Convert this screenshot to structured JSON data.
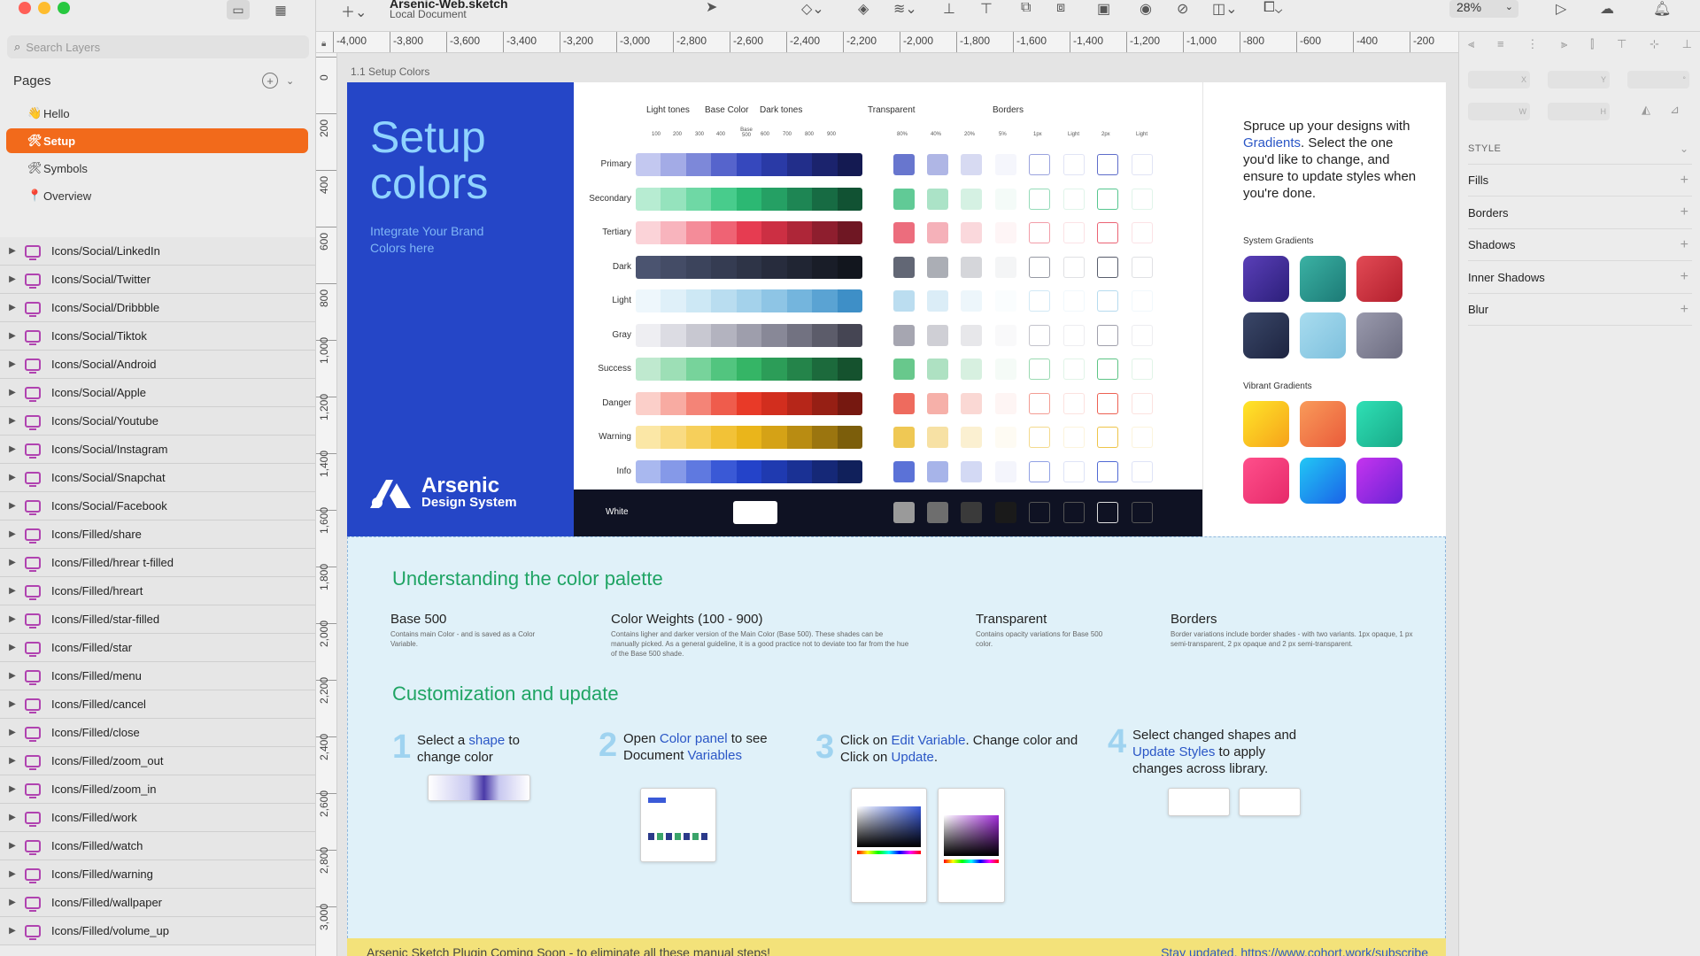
{
  "window": {
    "title": "Arsenic-Web.sketch",
    "subtitle": "Local Document",
    "zoom": "28%"
  },
  "sidebar": {
    "search_placeholder": "Search Layers",
    "pages_label": "Pages",
    "pages": [
      {
        "label": "Hello",
        "icon": "hand-icon",
        "glyph": "👋"
      },
      {
        "label": "Setup",
        "icon": "tools-icon",
        "glyph": "🛠"
      },
      {
        "label": "Symbols",
        "icon": "tools-icon",
        "glyph": "🛠"
      },
      {
        "label": "Overview",
        "icon": "pin-icon",
        "glyph": "📍"
      }
    ],
    "layers": [
      "Icons/Social/LinkedIn",
      "Icons/Social/Twitter",
      "Icons/Social/Dribbble",
      "Icons/Social/Tiktok",
      "Icons/Social/Android",
      "Icons/Social/Apple",
      "Icons/Social/Youtube",
      "Icons/Social/Instagram",
      "Icons/Social/Snapchat",
      "Icons/Social/Facebook",
      "Icons/Filled/share",
      "Icons/Filled/hrear t-filled",
      "Icons/Filled/hreart",
      "Icons/Filled/star-filled",
      "Icons/Filled/star",
      "Icons/Filled/menu",
      "Icons/Filled/cancel",
      "Icons/Filled/close",
      "Icons/Filled/zoom_out",
      "Icons/Filled/zoom_in",
      "Icons/Filled/work",
      "Icons/Filled/watch",
      "Icons/Filled/warning",
      "Icons/Filled/wallpaper",
      "Icons/Filled/volume_up"
    ]
  },
  "ruler": {
    "h": [
      "-4,000",
      "-3,800",
      "-3,600",
      "-3,400",
      "-3,200",
      "-3,000",
      "-2,800",
      "-2,600",
      "-2,400",
      "-2,200",
      "-2,000",
      "-1,800",
      "-1,600",
      "-1,400",
      "-1,200",
      "-1,000",
      "-800",
      "-600",
      "-400",
      "-200"
    ],
    "v": [
      "0",
      "200",
      "400",
      "600",
      "800",
      "1,000",
      "1,200",
      "1,400",
      "1,600",
      "1,800",
      "2,000",
      "2,200",
      "2,400",
      "2,600",
      "2,800",
      "3,000"
    ]
  },
  "artboard": {
    "label": "1.1 Setup Colors"
  },
  "hero": {
    "title": "Setup colors",
    "subtitle": "Integrate Your Brand Colors here",
    "logo_word": "Arsenic",
    "logo_sub": "Design System"
  },
  "palette": {
    "groups": {
      "light": "Light tones",
      "base": "Base Color",
      "dark": "Dark tones",
      "transparent": "Transparent",
      "borders": "Borders"
    },
    "weights": [
      "100",
      "200",
      "300",
      "400",
      "Base 500",
      "600",
      "700",
      "800",
      "900"
    ],
    "transparency": [
      "80%",
      "40%",
      "20%",
      "5%"
    ],
    "border_labels": [
      "1px",
      "Light",
      "2px",
      "Light"
    ],
    "rows": [
      {
        "name": "Primary",
        "colors": [
          "#c3c8f0",
          "#a3abe6",
          "#7d88d9",
          "#5664cc",
          "#3648bd",
          "#2a3aa6",
          "#222e8a",
          "#1b236d",
          "#141a52"
        ],
        "tint": "#3648bd"
      },
      {
        "name": "Secondary",
        "colors": [
          "#b7ecd2",
          "#95e3bd",
          "#6fd8a5",
          "#48cc8c",
          "#2cb873",
          "#25a064",
          "#1e8654",
          "#176b43",
          "#115233"
        ],
        "tint": "#2cb873"
      },
      {
        "name": "Tertiary",
        "colors": [
          "#fbd3d8",
          "#f8b4bd",
          "#f48c99",
          "#ef6374",
          "#e63c51",
          "#cc2f43",
          "#ae2638",
          "#8e1e2e",
          "#6f1723"
        ],
        "tint": "#e63c51"
      },
      {
        "name": "Dark",
        "colors": [
          "#4b5470",
          "#444c66",
          "#3c445c",
          "#353c52",
          "#2e3447",
          "#272c3d",
          "#202533",
          "#191d28",
          "#12161e"
        ],
        "tint": "#2e3447"
      },
      {
        "name": "Light",
        "colors": [
          "#eef7fc",
          "#dff0f9",
          "#cde8f5",
          "#b9ddf0",
          "#a4d2eb",
          "#8ec5e5",
          "#74b5dd",
          "#5aa3d3",
          "#3e8fc7"
        ],
        "tint": "#a4d2eb"
      },
      {
        "name": "Gray",
        "colors": [
          "#eeeef2",
          "#dcdce3",
          "#c8c8d1",
          "#b3b3bf",
          "#9e9eac",
          "#888897",
          "#727281",
          "#5c5c6a",
          "#454553"
        ],
        "tint": "#888897"
      },
      {
        "name": "Success",
        "colors": [
          "#bfe9cf",
          "#9ddfb6",
          "#77d39b",
          "#52c57f",
          "#35b566",
          "#2c9d58",
          "#24844a",
          "#1c6a3c",
          "#15522e"
        ],
        "tint": "#35b566"
      },
      {
        "name": "Danger",
        "colors": [
          "#fbcfc9",
          "#f8aba2",
          "#f48477",
          "#ef5c4c",
          "#e83a28",
          "#d22e1e",
          "#b62619",
          "#961f14",
          "#761810"
        ],
        "tint": "#e83a28"
      },
      {
        "name": "Warning",
        "colors": [
          "#fbe7a6",
          "#f9db82",
          "#f6cf5b",
          "#f2c237",
          "#eab51b",
          "#d5a216",
          "#b98c12",
          "#9b750f",
          "#7c5e0b"
        ],
        "tint": "#eab51b"
      },
      {
        "name": "Info",
        "colors": [
          "#a9b8ef",
          "#8599e8",
          "#5f79e0",
          "#3a59d6",
          "#2443c9",
          "#1f3ab0",
          "#1a3194",
          "#152877",
          "#10205b"
        ],
        "tint": "#2443c9"
      }
    ],
    "white_label": "White"
  },
  "gradients": {
    "intro_a": "Spruce up your designs with ",
    "intro_link": "Gradients",
    "intro_b": ". Select the one you'd like to change, and ensure to update styles when you're done.",
    "system_label": "System Gradients",
    "vibrant_label": "Vibrant Gradients"
  },
  "lower": {
    "h_palette": "Understanding the color palette",
    "cols": [
      {
        "title": "Base 500",
        "desc": "Contains main Color - and is saved as a Color Variable."
      },
      {
        "title": "Color Weights (100 - 900)",
        "desc": "Contains ligher and darker version of the Main Color (Base 500). These shades can be manually picked. As a general guideline, it is a good practice not to deviate too far from the hue of the Base 500 shade."
      },
      {
        "title": "Transparent",
        "desc": "Contains opacity variations for Base 500 color."
      },
      {
        "title": "Borders",
        "desc": "Border variations include border shades - with two variants. 1px opaque, 1 px semi-transparent, 2 px opaque and 2 px semi-transparent."
      }
    ],
    "h_custom": "Customization and update",
    "steps": [
      {
        "num": "1",
        "a": "Select a ",
        "link": "shape",
        "b": " to change color"
      },
      {
        "num": "2",
        "a": "Open ",
        "link": "Color panel",
        "b": " to see Document ",
        "link2": "Variables"
      },
      {
        "num": "3",
        "a": "Click on ",
        "link": "Edit Variable",
        "b": ". Change color and Click on ",
        "link2": "Update",
        "c": "."
      },
      {
        "num": "4",
        "a": "Select changed shapes and ",
        "link": "Update Styles",
        "b": " to apply changes across library."
      }
    ],
    "banner_left": "Arsenic Sketch Plugin Coming Soon - to eliminate all these manual steps!",
    "banner_right": "Stay updated. https://www.cohort.work/subscribe"
  },
  "inspector": {
    "style": "STYLE",
    "sections": [
      "Fills",
      "Borders",
      "Shadows",
      "Inner Shadows",
      "Blur"
    ]
  }
}
